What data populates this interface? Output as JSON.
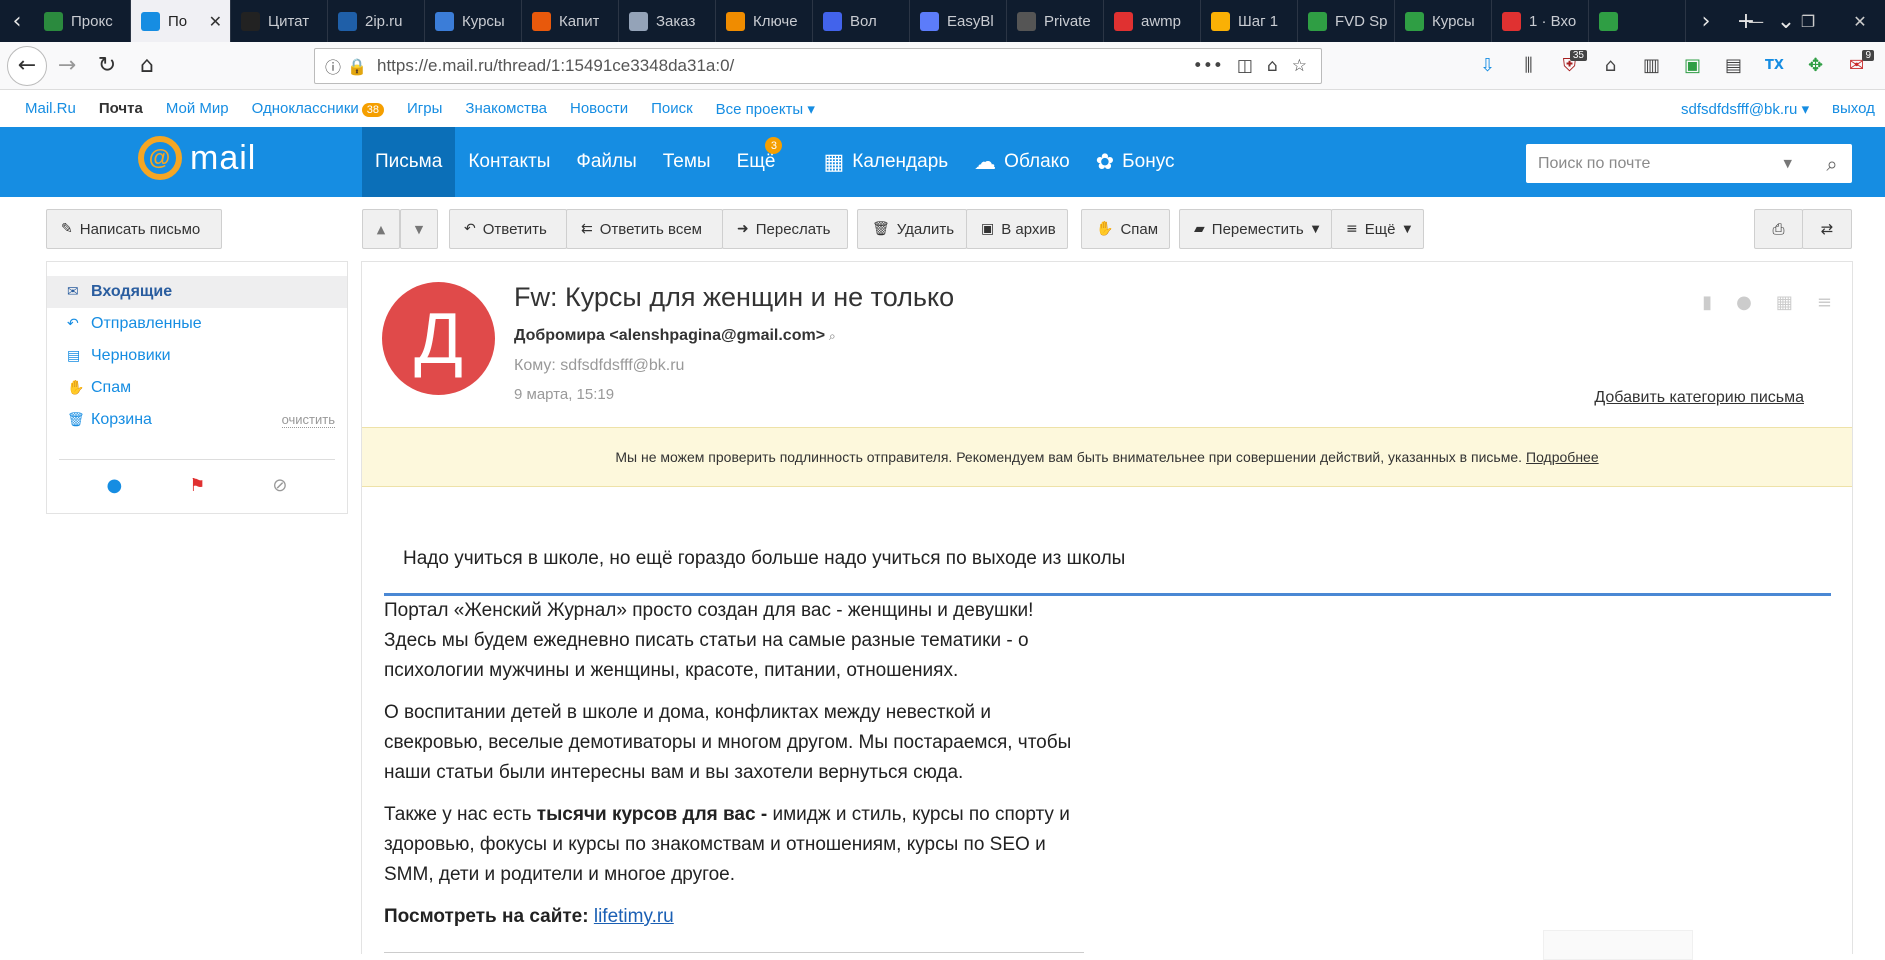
{
  "browser": {
    "tabs": [
      {
        "title": "Прокс",
        "fav_color": "#2b8a3e",
        "fav_icon": "shield-icon"
      },
      {
        "title": "По",
        "fav_color": "#168de2",
        "fav_icon": "at-icon",
        "active": true
      },
      {
        "title": "Цитат",
        "fav_color": "#222",
        "fav_icon": "quote-icon"
      },
      {
        "title": "2ip.ru",
        "fav_color": "#1f5fa8",
        "fav_icon": "ip-icon"
      },
      {
        "title": "Курсы",
        "fav_color": "#3b7dd8",
        "fav_icon": "gear-icon"
      },
      {
        "title": "Капит",
        "fav_color": "#e8590c",
        "fav_icon": "pizza-icon"
      },
      {
        "title": "Заказ",
        "fav_color": "#94a3b8",
        "fav_icon": "page-icon"
      },
      {
        "title": "Ключе",
        "fav_color": "#f08c00",
        "fav_icon": "b-icon"
      },
      {
        "title": "Вол",
        "fav_color": "#4263eb",
        "fav_icon": "wolf-icon"
      },
      {
        "title": "EasyBl",
        "fav_color": "#5c7cfa",
        "fav_icon": "easy-icon"
      },
      {
        "title": "Private",
        "fav_color": "#555",
        "fav_icon": "private-icon"
      },
      {
        "title": "awmp",
        "fav_color": "#e03131",
        "fav_icon": "awmp-icon"
      },
      {
        "title": "Шаг 1",
        "fav_color": "#fab005",
        "fav_icon": "steps-icon"
      },
      {
        "title": "FVD Sp",
        "fav_color": "#2f9e44",
        "fav_icon": "fvd-icon"
      },
      {
        "title": "Курсы",
        "fav_color": "#2f9e44",
        "fav_icon": "chat-icon"
      },
      {
        "title": "1 · Вхо",
        "fav_color": "#e03131",
        "fav_icon": "gmail-icon"
      },
      {
        "title": "",
        "fav_color": "#2f9e44",
        "fav_icon": "g-icon"
      }
    ],
    "url": "https://e.mail.ru/thread/1:15491ce3348da31a:0/",
    "toolbar_badges": {
      "ublock": "35",
      "mail": "9"
    }
  },
  "portal": {
    "links": [
      {
        "label": "Mail.Ru",
        "bold": false
      },
      {
        "label": "Почта",
        "bold": true
      },
      {
        "label": "Мой Мир",
        "bold": false
      },
      {
        "label": "Одноклассники",
        "bold": false,
        "badge": "38"
      },
      {
        "label": "Игры",
        "bold": false
      },
      {
        "label": "Знакомства",
        "bold": false
      },
      {
        "label": "Новости",
        "bold": false
      },
      {
        "label": "Поиск",
        "bold": false
      },
      {
        "label": "Все проекты ▾",
        "bold": false
      }
    ],
    "user": "sdfsdfdsfff@bk.ru ▾",
    "logout": "выход"
  },
  "header": {
    "logo": "mail",
    "nav": [
      {
        "label": "Письма",
        "active": true
      },
      {
        "label": "Контакты"
      },
      {
        "label": "Файлы"
      },
      {
        "label": "Темы"
      },
      {
        "label": "Ещё",
        "badge": "3"
      }
    ],
    "apps": [
      {
        "label": "Календарь",
        "icon": "calendar-icon"
      },
      {
        "label": "Облако",
        "icon": "cloud-icon"
      },
      {
        "label": "Бонус",
        "icon": "bonus-icon"
      }
    ],
    "search_placeholder": "Поиск по почте"
  },
  "toolbar": {
    "compose": "Написать письмо",
    "reply": "Ответить",
    "reply_all": "Ответить всем",
    "forward": "Переслать",
    "delete": "Удалить",
    "archive": "В архив",
    "spam": "Спам",
    "move": "Переместить",
    "more": "Ещё"
  },
  "sidebar": {
    "folders": [
      {
        "label": "Входящие",
        "icon": "inbox-icon",
        "active": true
      },
      {
        "label": "Отправленные",
        "icon": "sent-icon"
      },
      {
        "label": "Черновики",
        "icon": "drafts-icon"
      },
      {
        "label": "Спам",
        "icon": "spam-icon"
      },
      {
        "label": "Корзина",
        "icon": "trash-icon",
        "action": "очистить"
      }
    ]
  },
  "letter": {
    "avatar_letter": "Д",
    "avatar_color": "#e04a4a",
    "subject": "Fw: Курсы для женщин и не только",
    "from": "Добромира <alenshpagina@gmail.com>",
    "to": "Кому: sdfsdfdsfff@bk.ru",
    "date": "9 марта, 15:19",
    "add_category": "Добавить категорию письма",
    "warning": "Мы не можем проверить подлинность отправителя. Рекомендуем вам быть внимательнее при совершении действий, указанных в письме.",
    "warning_link": "Подробнее",
    "quote": "Надо учиться в школе, но ещё гораздо больше надо учиться по выходе из школы",
    "p1": "Портал «Женский Журнал» просто создан для вас - женщины и девушки! Здесь мы будем ежедневно писать статьи на самые разные тематики - о психологии мужчины и женщины, красоте, питании, отношениях.",
    "p2": "О воспитании детей в школе и дома, конфликтах между невесткой и свекровью, веселые демотиваторы и многом другом. Мы постараемся, чтобы наши статьи были интересны вам и вы захотели вернуться сюда.",
    "p3_pre": "Также у нас есть ",
    "p3_bold": "тысячи курсов для вас -",
    "p3_post": " имидж и стиль, курсы по спорту и здоровью, фокусы и курсы по знакомствам и отношениям, курсы по SEO и SMM, дети и родители и многое другое.",
    "site_label": "Посмотреть на сайте:",
    "site_link": "lifetimy.ru"
  },
  "colors": {
    "accent": "#168de2",
    "header_active": "#0b6fb8",
    "badge": "#f59f00",
    "warning_bg": "#fdf8dc"
  }
}
